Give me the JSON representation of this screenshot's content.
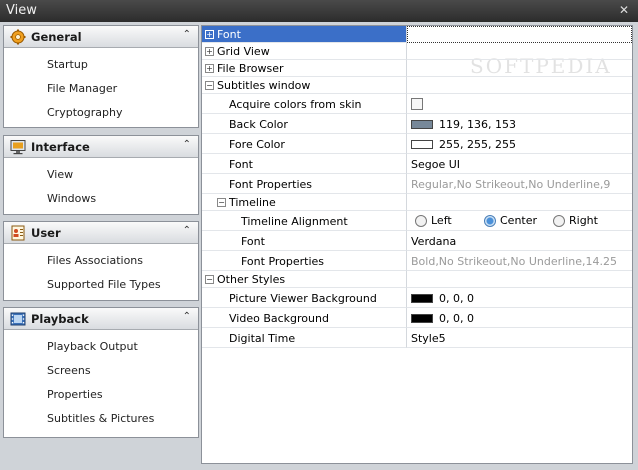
{
  "window": {
    "title": "View",
    "close_glyph": "✕"
  },
  "nav": {
    "groups": [
      {
        "label": "General",
        "icon": "gear-icon",
        "chevron": "⌃",
        "items": [
          "Startup",
          "File Manager",
          "Cryptography"
        ]
      },
      {
        "label": "Interface",
        "icon": "monitor-icon",
        "chevron": "⌃",
        "items": [
          "View",
          "Windows"
        ]
      },
      {
        "label": "User",
        "icon": "user-card-icon",
        "chevron": "⌃",
        "items": [
          "Files Associations",
          "Supported File Types"
        ]
      },
      {
        "label": "Playback",
        "icon": "film-icon",
        "chevron": "⌃",
        "items": [
          "Playback Output",
          "Screens",
          "Properties",
          "Subtitles & Pictures"
        ]
      }
    ]
  },
  "grid": {
    "watermark": "SOFTPEDIA",
    "rows": [
      {
        "name": "Font",
        "expander": "+",
        "selected": true
      },
      {
        "name": "Grid View",
        "expander": "+"
      },
      {
        "name": "File Browser",
        "expander": "+"
      },
      {
        "name": "Subtitles window",
        "expander": "−"
      },
      {
        "name": "Acquire colors from skin",
        "value_type": "checkbox",
        "checked": false
      },
      {
        "name": "Back Color",
        "value": "119, 136, 153",
        "swatch": "#778899"
      },
      {
        "name": "Fore Color",
        "value": "255, 255, 255",
        "swatch": "#ffffff"
      },
      {
        "name": "Font",
        "value": "Segoe UI"
      },
      {
        "name": "Font Properties",
        "value": "Regular,No Strikeout,No Underline,9"
      },
      {
        "name": "Timeline",
        "expander": "−"
      },
      {
        "name": "Timeline Alignment",
        "radios": [
          "Left",
          "Center",
          "Right"
        ],
        "radio_selected": "Center"
      },
      {
        "name": "Font",
        "value": "Verdana"
      },
      {
        "name": "Font Properties",
        "value": "Bold,No Strikeout,No Underline,14.25"
      },
      {
        "name": "Other Styles",
        "expander": "−"
      },
      {
        "name": "Picture Viewer Background",
        "value": "0, 0, 0",
        "swatch": "#000000"
      },
      {
        "name": "Video Background",
        "value": "0, 0, 0",
        "swatch": "#000000"
      },
      {
        "name": "Digital Time",
        "value": "Style5"
      }
    ]
  }
}
